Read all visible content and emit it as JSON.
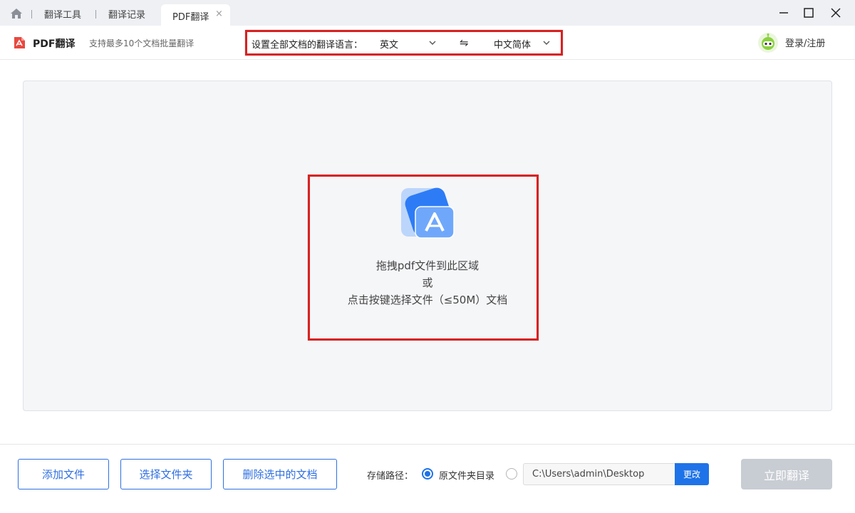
{
  "tabs": {
    "items": [
      {
        "label": "翻译工具"
      },
      {
        "label": "翻译记录"
      },
      {
        "label": "PDF翻译",
        "active": true
      }
    ],
    "close_glyph": "×"
  },
  "window_controls": [
    "minimize-icon",
    "maximize-icon",
    "close-icon"
  ],
  "header": {
    "title": "PDF翻译",
    "subtitle": "支持最多10个文档批量翻译",
    "lang_label": "设置全部文档的翻译语言：",
    "source_lang": "英文",
    "swap_glyph": "⇋",
    "target_lang": "中文简体",
    "login": "登录/注册"
  },
  "drop_area": {
    "line1": "拖拽pdf文件到此区域",
    "line2": "或",
    "line3": "点击按键选择文件（≤50M）文档"
  },
  "bottom": {
    "add_file": "添加文件",
    "choose_folder": "选择文件夹",
    "delete_selected": "删除选中的文档",
    "save_path_label": "存储路径：",
    "original_dir": "原文件夹目录",
    "custom_path": "C:\\Users\\admin\\Desktop",
    "change": "更改",
    "translate_now": "立即翻译"
  },
  "colors": {
    "accent": "#1e73e8",
    "highlight_border": "#d92121",
    "disabled_button": "#c8ccd3",
    "tab_bar": "#eef0f4",
    "drop_area_bg": "#f5f6f8"
  }
}
